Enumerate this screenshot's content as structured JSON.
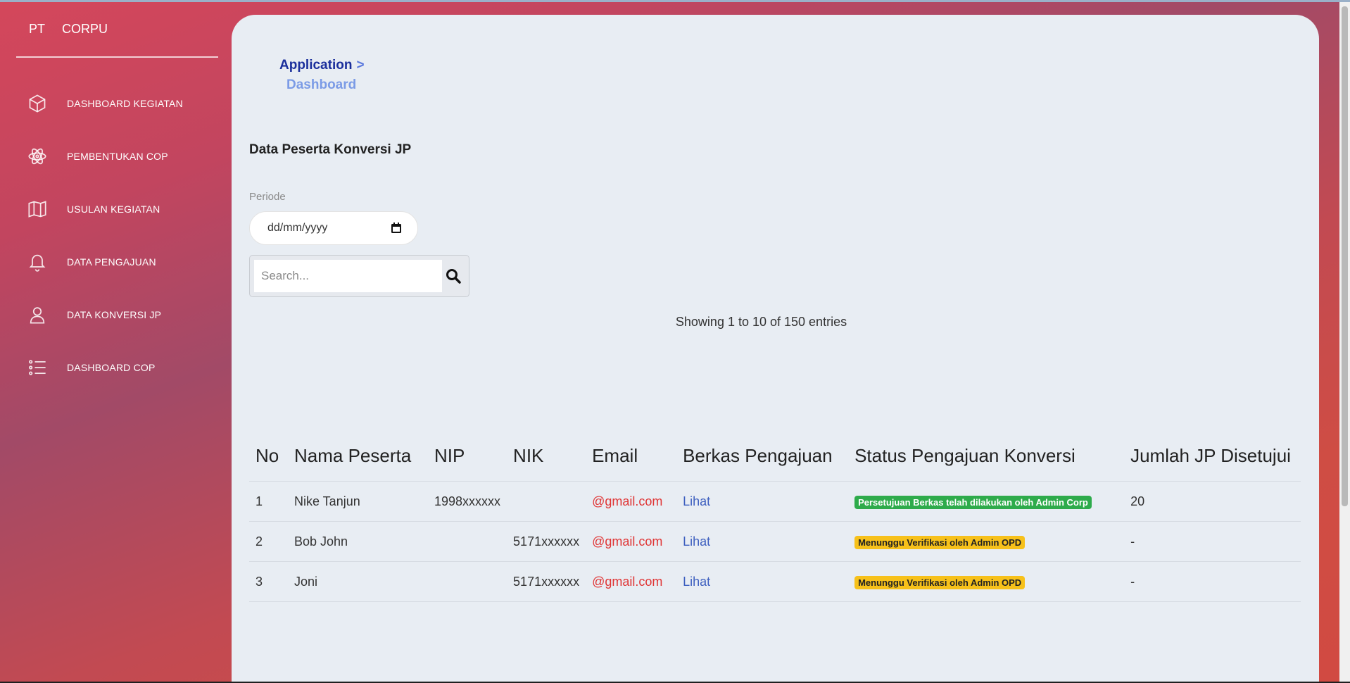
{
  "brand": {
    "part1": "PT",
    "part2": "CORPU"
  },
  "sidebar": {
    "items": [
      {
        "label": "DASHBOARD KEGIATAN",
        "icon": "cube-icon"
      },
      {
        "label": "PEMBENTUKAN COP",
        "icon": "atom-icon"
      },
      {
        "label": "USULAN KEGIATAN",
        "icon": "map-icon"
      },
      {
        "label": "DATA PENGAJUAN",
        "icon": "bell-icon"
      },
      {
        "label": "DATA KONVERSI JP",
        "icon": "user-icon"
      },
      {
        "label": "DASHBOARD COP",
        "icon": "list-icon"
      }
    ]
  },
  "breadcrumb": {
    "parent": "Application",
    "separator": ">",
    "current": "Dashboard"
  },
  "page": {
    "title": "Data Peserta Konversi JP"
  },
  "filter": {
    "periode_label": "Periode",
    "date_value": "dd/mm/yyyy"
  },
  "search": {
    "placeholder": "Search..."
  },
  "table": {
    "info": "Showing 1 to 10 of 150 entries",
    "headers": [
      "No",
      "Nama Peserta",
      "NIP",
      "NIK",
      "Email",
      "Berkas Pengajuan",
      "Status Pengajuan Konversi",
      "Jumlah JP Disetujui"
    ],
    "rows": [
      {
        "no": "1",
        "nama": "Nike Tanjun",
        "nip": "1998xxxxxx",
        "nik": "",
        "email": "@gmail.com",
        "berkas": "Lihat",
        "status": "Persetujuan Berkas telah dilakukan oleh Admin Corp",
        "status_color": "#2eab4b",
        "jp": "20"
      },
      {
        "no": "2",
        "nama": "Bob John",
        "nip": "",
        "nik": "5171xxxxxx",
        "email": "@gmail.com",
        "berkas": "Lihat",
        "status": "Menunggu Verifikasi oleh Admin OPD",
        "status_color": "#f7c11a",
        "jp": "-"
      },
      {
        "no": "3",
        "nama": "Joni",
        "nip": "",
        "nik": "5171xxxxxx",
        "email": "@gmail.com",
        "berkas": "Lihat",
        "status": "Menunggu Verifikasi oleh Admin OPD",
        "status_color": "#f7c11a",
        "jp": "-"
      }
    ]
  }
}
